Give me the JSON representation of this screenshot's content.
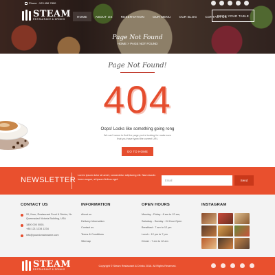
{
  "header": {
    "phone": "Phone : 123 456 7890",
    "logo_title": "STEAM",
    "logo_subtitle": "RESTAURANT & DRINKS",
    "nav": [
      "HOME",
      "ABOUT US",
      "RESERVATION",
      "OUR MENU",
      "OUR BLOG",
      "CONTACT US"
    ],
    "book_label": "BOOK YOUR TABLE",
    "top_social_icons": [
      "facebook-icon",
      "twitter-icon",
      "google-plus-icon",
      "pinterest-icon",
      "vimeo-icon"
    ]
  },
  "hero": {
    "title": "Page Not Found",
    "breadcrumb": "HOME  >  PAGE NOT FOUND"
  },
  "main": {
    "subtitle": "Page Not Found!",
    "code": "404",
    "oops": "Oops! Looks like something going rong",
    "description": "We can't seem to find the page you're looking for make sure that you have typed the current URL",
    "button": "GO TO HOME"
  },
  "newsletter": {
    "title": "NEWSLETTER",
    "text": "Lorem ipsum dolor sit amet, consectetur adipiscing elit. Nam iaculis lorem augue, at ipsum finibus eget.",
    "placeholder": "Email",
    "button": "Send"
  },
  "footer": {
    "contact": {
      "heading": "CONTACT US",
      "address": "20, Noor, Restaurant Food & Drinks, Nr. Queensdad Victoria Building, USA",
      "phone1": "1800 000 0000,",
      "phone2": "+88 121 1234 1234",
      "email": "info@yourdomainname.com"
    },
    "information": {
      "heading": "INFORMATION",
      "links": [
        "About us",
        "Delivery Information",
        "Contact us",
        "Terms & Conditions",
        "Sitemap"
      ]
    },
    "hours": {
      "heading": "OPEN HOURS",
      "lines": [
        "Monday - Friday : 8 am to 12 am,",
        "Saturday - Sunday : 24 Hour Open",
        "Breakfast : 7 am to 12 pm",
        "Lunch : 12 pm to 7 pm",
        "Dinner : 7 am to 12 am"
      ]
    },
    "instagram": {
      "heading": "INSTAGRAM",
      "photo_count": 9
    },
    "copyright": "Copyright © Steam Restaurant & Drinks 2016. All Rights Reserved.",
    "bottom_social_icons": [
      "facebook-icon",
      "twitter-icon",
      "google-plus-icon",
      "pinterest-icon",
      "vimeo-icon"
    ]
  },
  "colors": {
    "accent": "#e9502e",
    "dark_accent": "#c9381a"
  }
}
